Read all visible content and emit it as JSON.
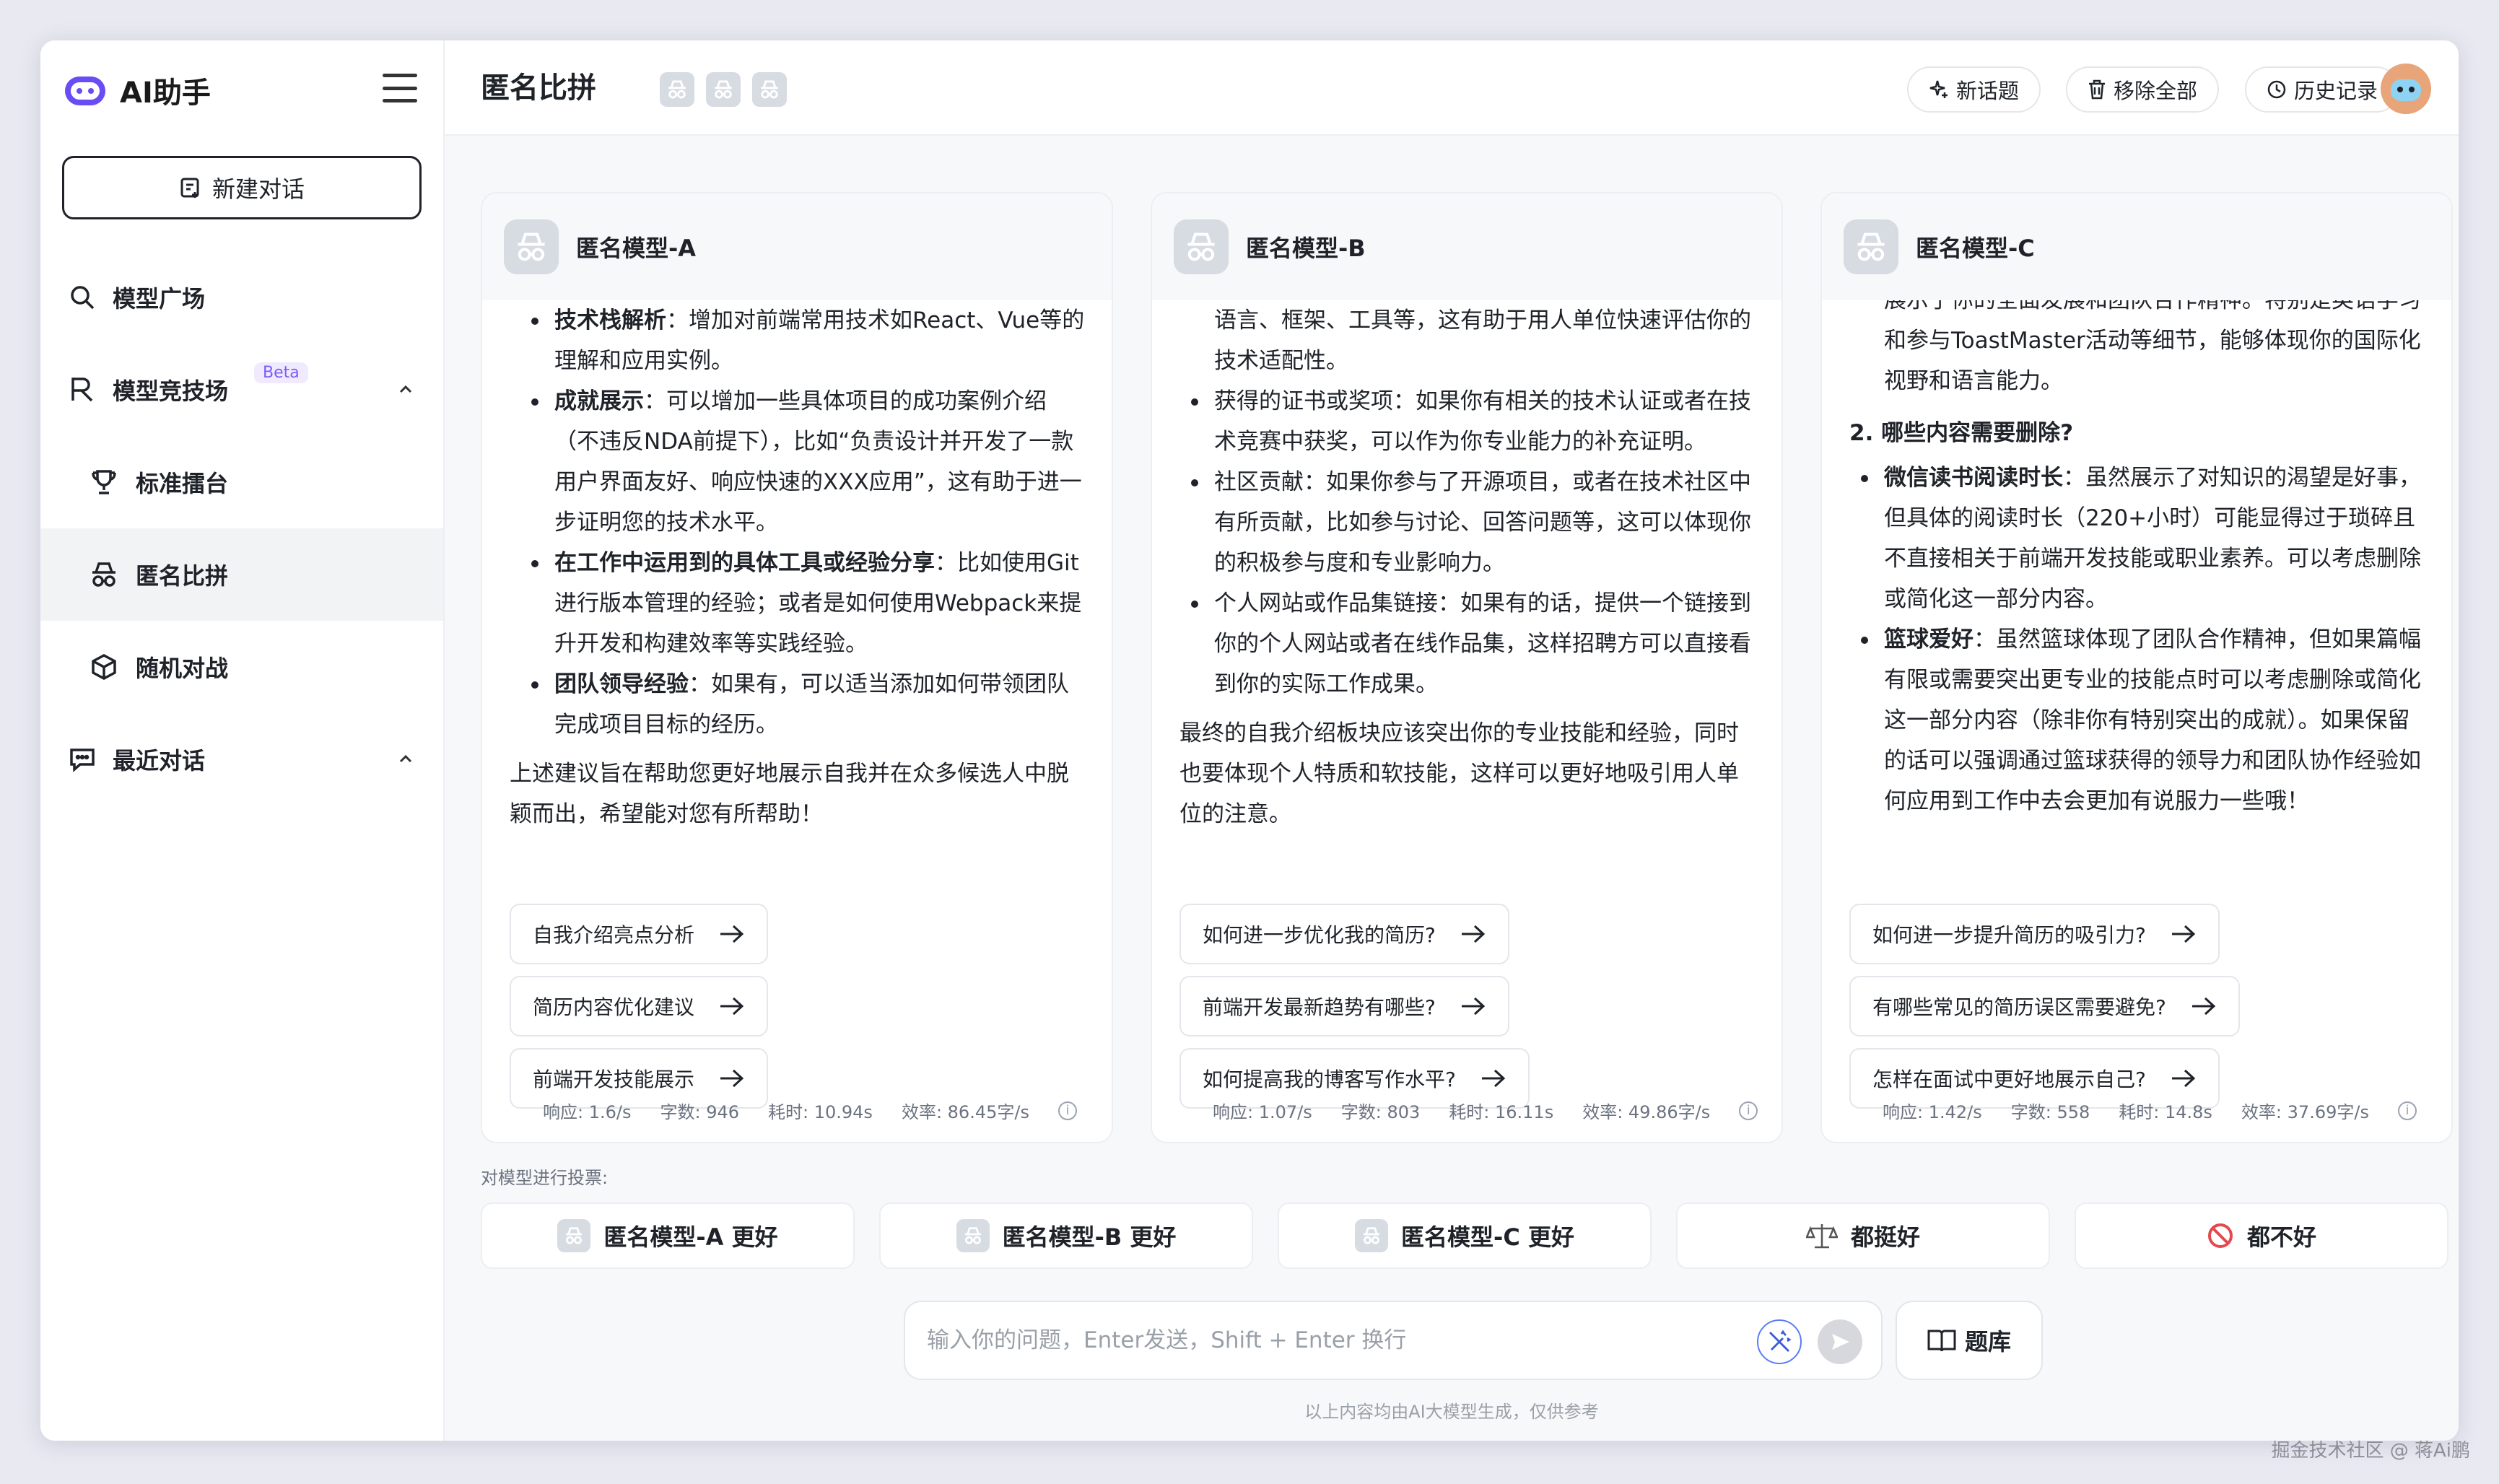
{
  "app": {
    "name": "AI助手",
    "new_chat": "新建对话"
  },
  "sidebar": {
    "items": [
      {
        "label": "模型广场"
      },
      {
        "label": "模型竞技场",
        "badge": "Beta"
      },
      {
        "label": "标准擂台"
      },
      {
        "label": "匿名比拼"
      },
      {
        "label": "随机对战"
      },
      {
        "label": "最近对话"
      }
    ]
  },
  "header": {
    "title": "匿名比拼",
    "buttons": {
      "new_topic": "新话题",
      "remove_all": "移除全部",
      "history": "历史记录"
    }
  },
  "models": [
    {
      "name": "匿名模型-A",
      "suggestions": [
        "自我介绍亮点分析",
        "简历内容优化建议",
        "前端开发技能展示"
      ],
      "stats": {
        "speed": "响应: 1.6/s",
        "chars": "字数: 946",
        "time": "耗时: 10.94s",
        "eff": "效率: 86.45字/s"
      },
      "content": {
        "b1_title": "技术栈解析",
        "b1_text": "：增加对前端常用技术如React、Vue等的理解和应用实例。",
        "b2_title": "成就展示",
        "b2_text": "：可以增加一些具体项目的成功案例介绍（不违反NDA前提下），比如“负责设计并开发了一款用户界面友好、响应快速的XXX应用”，这有助于进一步证明您的技术水平。",
        "b3_title": "在工作中运用到的具体工具或经验分享",
        "b3_text": "：比如使用Git进行版本管理的经验；或者是如何使用Webpack来提升开发和构建效率等实践经验。",
        "b4_title": "团队领导经验",
        "b4_text": "：如果有，可以适当添加如何带领团队完成项目目标的经历。",
        "p1": "上述建议旨在帮助您更好地展示自我并在众多候选人中脱颖而出，希望能对您有所帮助！"
      }
    },
    {
      "name": "匿名模型-B",
      "suggestions": [
        "如何进一步优化我的简历?",
        "前端开发最新趋势有哪些?",
        "如何提高我的博客写作水平?"
      ],
      "stats": {
        "speed": "响应: 1.07/s",
        "chars": "字数: 803",
        "time": "耗时: 16.11s",
        "eff": "效率: 49.86字/s"
      },
      "content": {
        "cont": "语言、框架、工具等，这有助于用人单位快速评估你的技术适配性。",
        "b1": "获得的证书或奖项：如果你有相关的技术认证或者在技术竞赛中获奖，可以作为你专业能力的补充证明。",
        "b2": "社区贡献：如果你参与了开源项目，或者在技术社区中有所贡献，比如参与讨论、回答问题等，这可以体现你的积极参与度和专业影响力。",
        "b3": "个人网站或作品集链接：如果有的话，提供一个链接到你的个人网站或者在线作品集，这样招聘方可以直接看到你的实际工作成果。",
        "p1": "最终的自我介绍板块应该突出你的专业技能和经验，同时也要体现个人特质和软技能，这样可以更好地吸引用人单位的注意。"
      }
    },
    {
      "name": "匿名模型-C",
      "suggestions": [
        "如何进一步提升简历的吸引力?",
        "有哪些常见的简历误区需要避免?",
        "怎样在面试中更好地展示自己?"
      ],
      "stats": {
        "speed": "响应: 1.42/s",
        "chars": "字数: 558",
        "time": "耗时: 14.8s",
        "eff": "效率: 37.69字/s"
      },
      "content": {
        "cont": "展示了你的全面发展和团队合作精神。特别是英语学习和参与ToastMaster活动等细节，能够体现你的国际化视野和语言能力。",
        "h2": "2. 哪些内容需要删除?",
        "b1_title": "微信读书阅读时长",
        "b1_text": "：虽然展示了对知识的渴望是好事，但具体的阅读时长（220+小时）可能显得过于琐碎且不直接相关于前端开发技能或职业素养。可以考虑删除或简化这一部分内容。",
        "b2_title": "篮球爱好",
        "b2_text": "：虽然篮球体现了团队合作精神，但如果篇幅有限或需要突出更专业的技能点时可以考虑删除或简化这一部分内容（除非你有特别突出的成就）。如果保留的话可以强调通过篮球获得的领导力和团队协作经验如何应用到工作中去会更加有说服力一些哦！"
      }
    }
  ],
  "vote": {
    "label": "对模型进行投票:",
    "options": [
      "匿名模型-A 更好",
      "匿名模型-B 更好",
      "匿名模型-C 更好",
      "都挺好",
      "都不好"
    ]
  },
  "input": {
    "placeholder": "输入你的问题，Enter发送，Shift + Enter 换行",
    "bank_label": "题库"
  },
  "footer": {
    "disclaimer": "以上内容均由AI大模型生成，仅供参考",
    "watermark": "掘金技术社区 @ 蒋Ai鹏"
  }
}
